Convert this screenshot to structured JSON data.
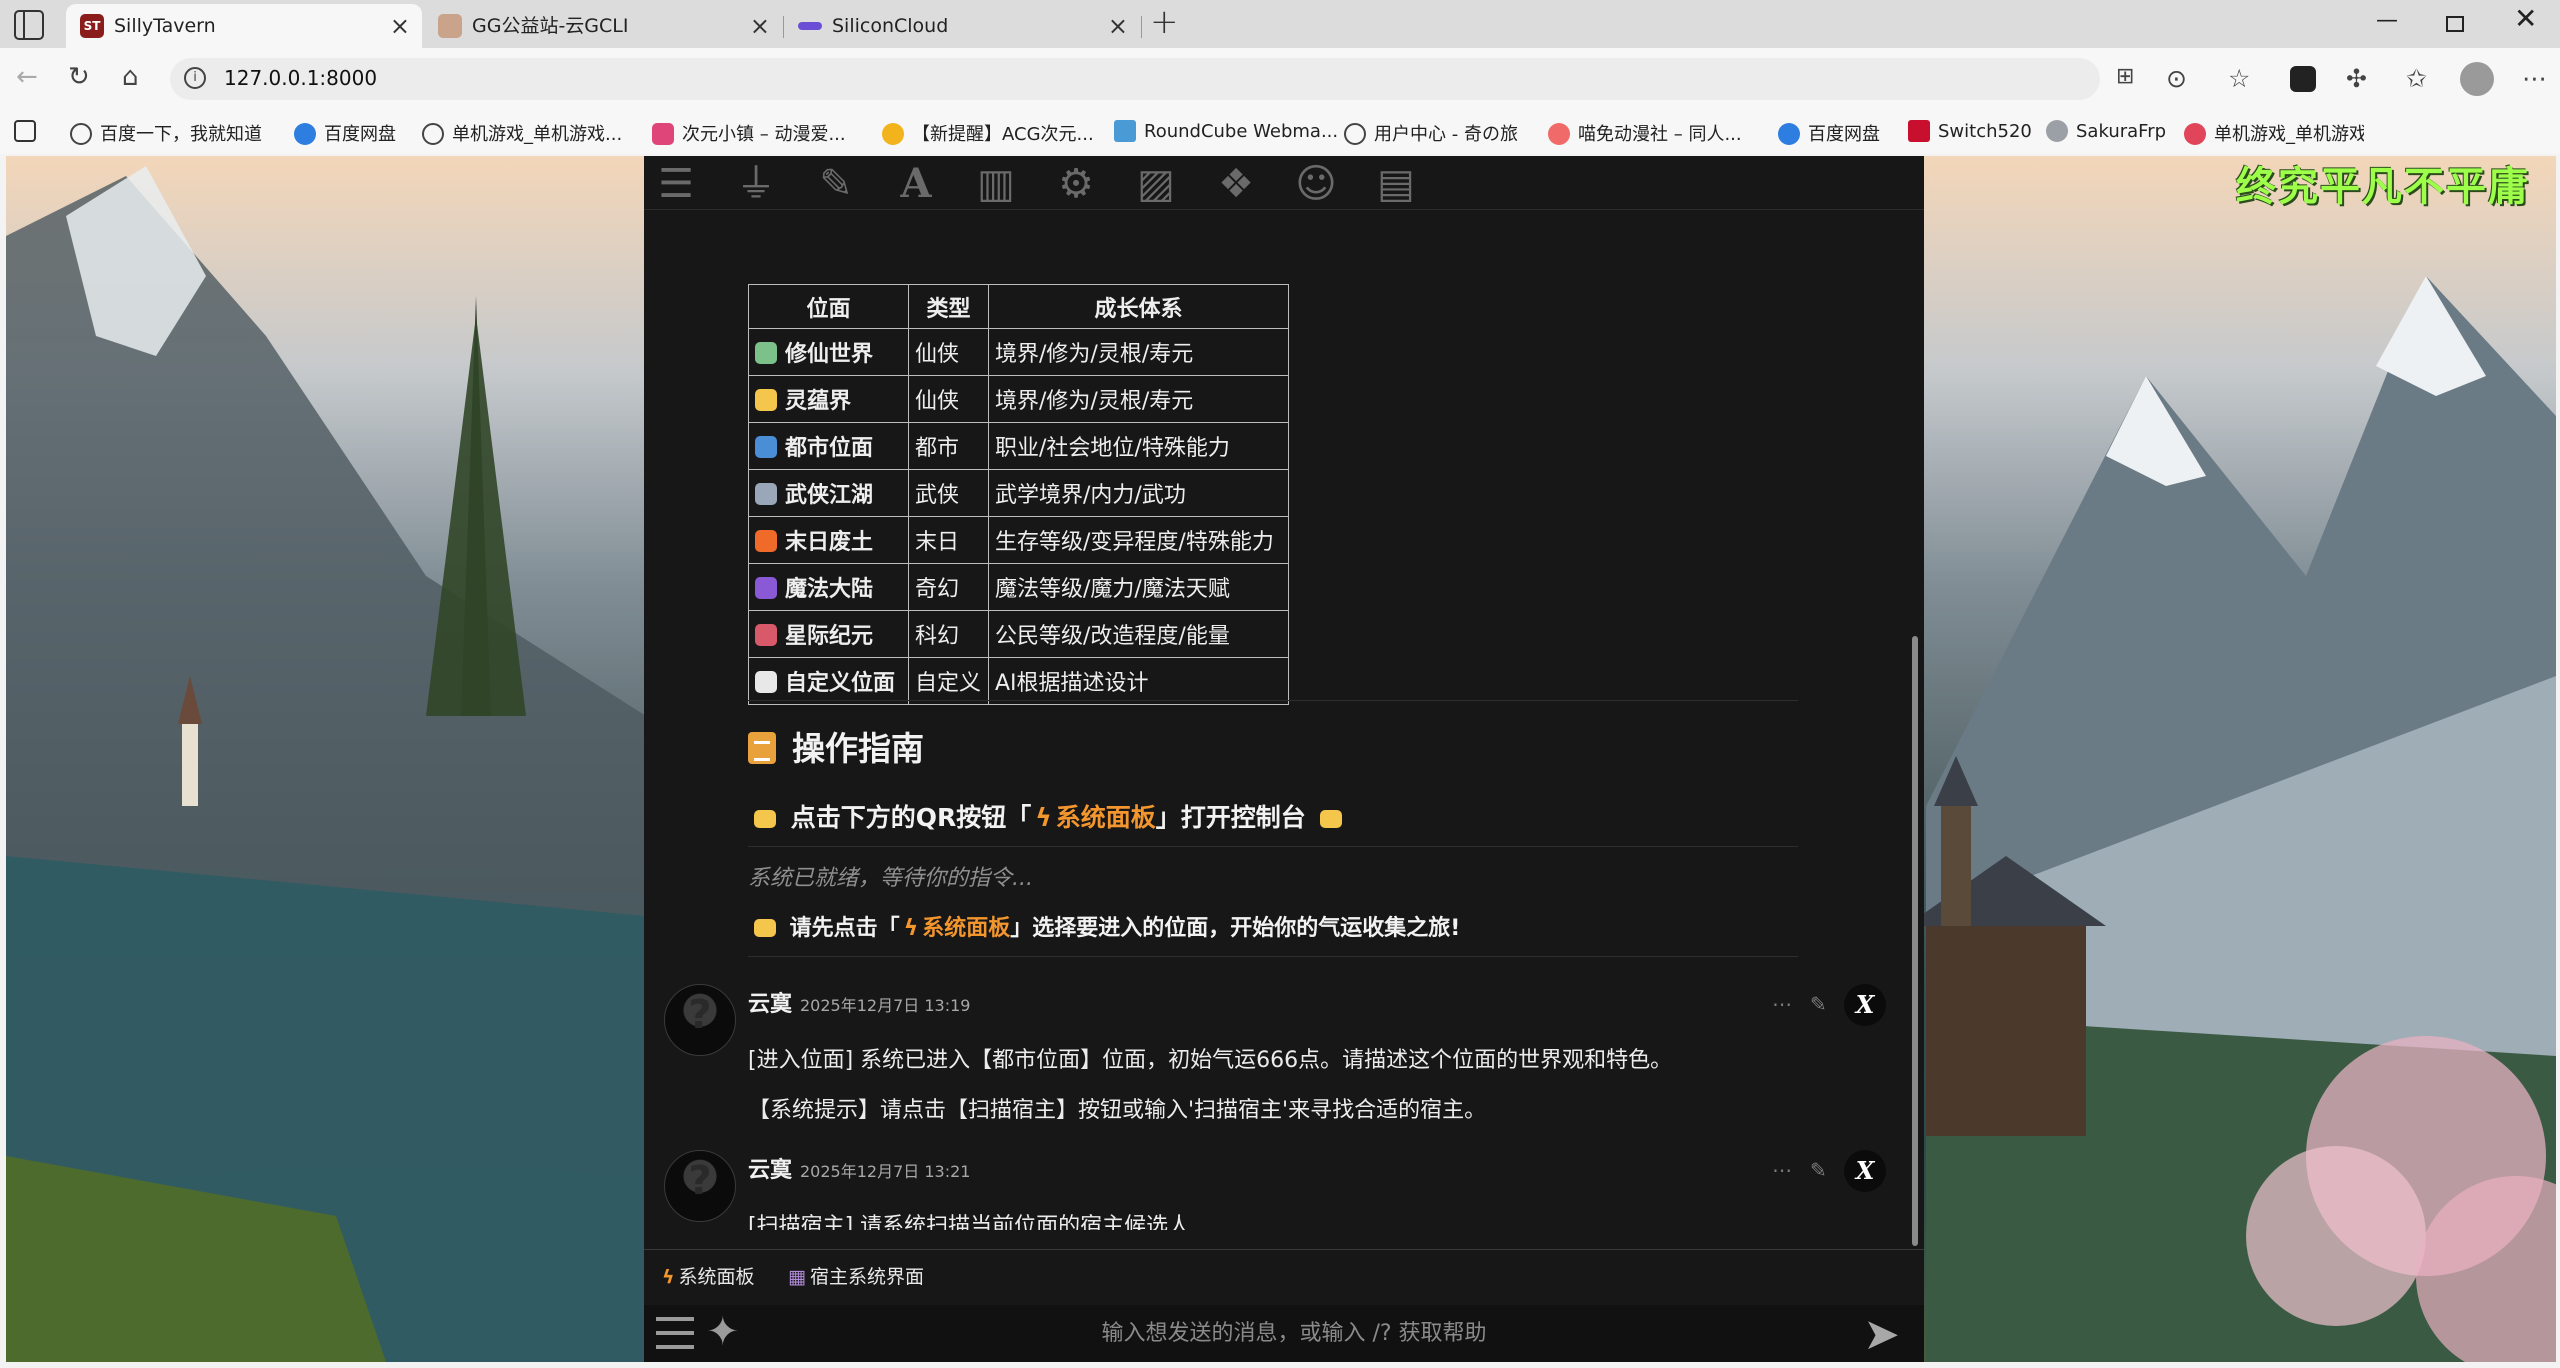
{
  "browser": {
    "tabs": [
      {
        "title": "SillyTavern",
        "favicon_color": "#8a1c1c",
        "active": true
      },
      {
        "title": "GG公益站-云GCLI",
        "favicon_color": "#c9a48a",
        "active": false
      },
      {
        "title": "SiliconCloud",
        "favicon_color": "#6a4fd6",
        "active": false
      }
    ],
    "url": "127.0.0.1:8000",
    "bookmarks": [
      {
        "label": "百度一下，我就知道",
        "icon": "globe-icon"
      },
      {
        "label": "百度网盘",
        "icon": "baidu-pan-icon"
      },
      {
        "label": "单机游戏_单机游戏...",
        "icon": "globe-icon"
      },
      {
        "label": "次元小镇 – 动漫爱...",
        "icon": "d-icon"
      },
      {
        "label": "【新提醒】ACG次元...",
        "icon": "trophy-icon"
      },
      {
        "label": "RoundCube Webma...",
        "icon": "cube-icon"
      },
      {
        "label": "用户中心 - 奇の旅",
        "icon": "globe-icon"
      },
      {
        "label": "喵免动漫社 – 同人...",
        "icon": "paw-icon"
      },
      {
        "label": "百度网盘",
        "icon": "baidu-pan-icon"
      },
      {
        "label": "Switch520",
        "icon": "switch-icon"
      },
      {
        "label": "SakuraFrp",
        "icon": "sakura-icon"
      },
      {
        "label": "单机游戏_单机游戏...",
        "icon": "game-icon"
      }
    ]
  },
  "background": {
    "title": "终究平凡不平庸",
    "title_color": "#9dff4a"
  },
  "topnav": [
    "sliders-icon",
    "plug-icon",
    "pencil-icon",
    "font-icon",
    "book-icon",
    "user-gear-icon",
    "image-icon",
    "cubes-icon",
    "smile-icon",
    "id-card-icon"
  ],
  "worlds_table": {
    "headers": [
      "位面",
      "类型",
      "成长体系"
    ],
    "rows": [
      {
        "emoji_color": "#7cc08a",
        "name": "修仙世界",
        "type": "仙侠",
        "growth": "境界/修为/灵根/寿元"
      },
      {
        "emoji_color": "#f4c64b",
        "name": "灵蕴界",
        "type": "仙侠",
        "growth": "境界/修为/灵根/寿元"
      },
      {
        "emoji_color": "#4a8ed6",
        "name": "都市位面",
        "type": "都市",
        "growth": "职业/社会地位/特殊能力"
      },
      {
        "emoji_color": "#9aa7b8",
        "name": "武侠江湖",
        "type": "武侠",
        "growth": "武学境界/内力/武功"
      },
      {
        "emoji_color": "#f06a2a",
        "name": "末日废土",
        "type": "末日",
        "growth": "生存等级/变异程度/特殊能力"
      },
      {
        "emoji_color": "#8a5ad6",
        "name": "魔法大陆",
        "type": "奇幻",
        "growth": "魔法等级/魔力/魔法天赋"
      },
      {
        "emoji_color": "#d85a6a",
        "name": "星际纪元",
        "type": "科幻",
        "growth": "公民等级/改造程度/能量"
      },
      {
        "emoji_color": "#e8e8e8",
        "name": "自定义位面",
        "type": "自定义",
        "growth": "AI根据描述设计"
      }
    ]
  },
  "guide": {
    "title": "操作指南",
    "line_prefix": "点击下方的QR按钮「",
    "line_panel": "系统面板",
    "line_suffix": "」打开控制台",
    "status": "系统已就绪，等待你的指令...",
    "prompt_prefix": "请先点击「",
    "prompt_panel": "系统面板",
    "prompt_suffix": "」选择要进入的位面，开始你的气运收集之旅!"
  },
  "messages": [
    {
      "name": "云寞",
      "time": "2025年12月7日 13:19",
      "lines": [
        "[进入位面] 系统已进入【都市位面】位面，初始气运666点。请描述这个位面的世界观和特色。",
        "【系统提示】请点击【扫描宿主】按钮或输入'扫描宿主'来寻找合适的宿主。"
      ]
    },
    {
      "name": "云寞",
      "time": "2025年12月7日 13:21",
      "lines": [
        "[扫描宿主] 请系统扫描当前位面的宿主候选人"
      ]
    }
  ],
  "quick_replies": [
    {
      "label": "系统面板",
      "icon": "bolt-icon"
    },
    {
      "label": "宿主系统界面",
      "icon": "abacus-icon"
    }
  ],
  "input": {
    "placeholder": "输入想发送的消息，或输入 /? 获取帮助"
  }
}
